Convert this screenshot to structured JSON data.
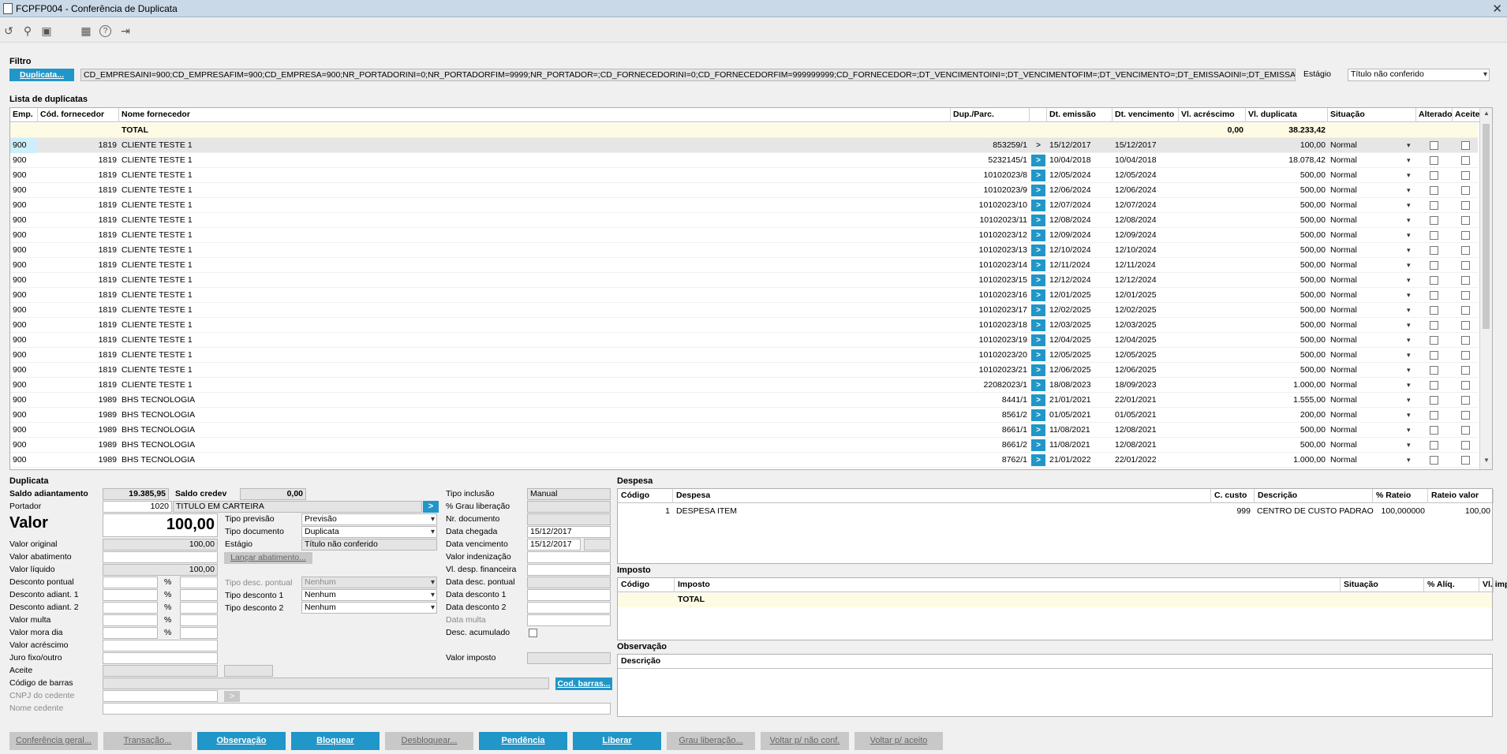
{
  "window": {
    "title": "FCPFP004 - Conferência de Duplicata",
    "close_glyph": "✕"
  },
  "toolbar": {
    "icons": [
      "undo-icon",
      "search-icon",
      "save-icon",
      "calendar-icon",
      "help-icon",
      "exit-icon"
    ],
    "glyphs": [
      "↺",
      "⚲",
      "▣",
      "▦",
      "?",
      "⇥"
    ]
  },
  "filtro": {
    "section": "Filtro",
    "duplicata_button": "Duplicata...",
    "filter_text": "CD_EMPRESAINI=900;CD_EMPRESAFIM=900;CD_EMPRESA=900;NR_PORTADORINI=0;NR_PORTADORFIM=9999;NR_PORTADOR=;CD_FORNECEDORINI=0;CD_FORNECEDORFIM=999999999;CD_FORNECEDOR=;DT_VENCIMENTOINI=;DT_VENCIMENTOFIM=;DT_VENCIMENTO=;DT_EMISSAOINI=;DT_EMISSAOFIM=",
    "estagio_label": "Estágio",
    "estagio_value": "Título não conferido"
  },
  "lista": {
    "section": "Lista de duplicatas",
    "columns": [
      "Emp.",
      "Cód. fornecedor",
      "Nome fornecedor",
      "Dup./Parc.",
      "",
      "Dt. emissão",
      "Dt. vencimento",
      "Vl. acréscimo",
      "Vl. duplicata",
      "Situação",
      "Alterado",
      "Aceite"
    ],
    "total": {
      "label": "TOTAL",
      "acrescimo": "0,00",
      "duplicata": "38.233,42"
    },
    "rows": [
      {
        "emp": "900",
        "cod": "1819",
        "nome": "CLIENTE TESTE 1",
        "dup": "853259/1",
        "emis": "15/12/2017",
        "venc": "15/12/2017",
        "valor": "100,00",
        "sit": "Normal"
      },
      {
        "emp": "900",
        "cod": "1819",
        "nome": "CLIENTE TESTE 1",
        "dup": "5232145/1",
        "emis": "10/04/2018",
        "venc": "10/04/2018",
        "valor": "18.078,42",
        "sit": "Normal"
      },
      {
        "emp": "900",
        "cod": "1819",
        "nome": "CLIENTE TESTE 1",
        "dup": "10102023/8",
        "emis": "12/05/2024",
        "venc": "12/05/2024",
        "valor": "500,00",
        "sit": "Normal"
      },
      {
        "emp": "900",
        "cod": "1819",
        "nome": "CLIENTE TESTE 1",
        "dup": "10102023/9",
        "emis": "12/06/2024",
        "venc": "12/06/2024",
        "valor": "500,00",
        "sit": "Normal"
      },
      {
        "emp": "900",
        "cod": "1819",
        "nome": "CLIENTE TESTE 1",
        "dup": "10102023/10",
        "emis": "12/07/2024",
        "venc": "12/07/2024",
        "valor": "500,00",
        "sit": "Normal"
      },
      {
        "emp": "900",
        "cod": "1819",
        "nome": "CLIENTE TESTE 1",
        "dup": "10102023/11",
        "emis": "12/08/2024",
        "venc": "12/08/2024",
        "valor": "500,00",
        "sit": "Normal"
      },
      {
        "emp": "900",
        "cod": "1819",
        "nome": "CLIENTE TESTE 1",
        "dup": "10102023/12",
        "emis": "12/09/2024",
        "venc": "12/09/2024",
        "valor": "500,00",
        "sit": "Normal"
      },
      {
        "emp": "900",
        "cod": "1819",
        "nome": "CLIENTE TESTE 1",
        "dup": "10102023/13",
        "emis": "12/10/2024",
        "venc": "12/10/2024",
        "valor": "500,00",
        "sit": "Normal"
      },
      {
        "emp": "900",
        "cod": "1819",
        "nome": "CLIENTE TESTE 1",
        "dup": "10102023/14",
        "emis": "12/11/2024",
        "venc": "12/11/2024",
        "valor": "500,00",
        "sit": "Normal"
      },
      {
        "emp": "900",
        "cod": "1819",
        "nome": "CLIENTE TESTE 1",
        "dup": "10102023/15",
        "emis": "12/12/2024",
        "venc": "12/12/2024",
        "valor": "500,00",
        "sit": "Normal"
      },
      {
        "emp": "900",
        "cod": "1819",
        "nome": "CLIENTE TESTE 1",
        "dup": "10102023/16",
        "emis": "12/01/2025",
        "venc": "12/01/2025",
        "valor": "500,00",
        "sit": "Normal"
      },
      {
        "emp": "900",
        "cod": "1819",
        "nome": "CLIENTE TESTE 1",
        "dup": "10102023/17",
        "emis": "12/02/2025",
        "venc": "12/02/2025",
        "valor": "500,00",
        "sit": "Normal"
      },
      {
        "emp": "900",
        "cod": "1819",
        "nome": "CLIENTE TESTE 1",
        "dup": "10102023/18",
        "emis": "12/03/2025",
        "venc": "12/03/2025",
        "valor": "500,00",
        "sit": "Normal"
      },
      {
        "emp": "900",
        "cod": "1819",
        "nome": "CLIENTE TESTE 1",
        "dup": "10102023/19",
        "emis": "12/04/2025",
        "venc": "12/04/2025",
        "valor": "500,00",
        "sit": "Normal"
      },
      {
        "emp": "900",
        "cod": "1819",
        "nome": "CLIENTE TESTE 1",
        "dup": "10102023/20",
        "emis": "12/05/2025",
        "venc": "12/05/2025",
        "valor": "500,00",
        "sit": "Normal"
      },
      {
        "emp": "900",
        "cod": "1819",
        "nome": "CLIENTE TESTE 1",
        "dup": "10102023/21",
        "emis": "12/06/2025",
        "venc": "12/06/2025",
        "valor": "500,00",
        "sit": "Normal"
      },
      {
        "emp": "900",
        "cod": "1819",
        "nome": "CLIENTE TESTE 1",
        "dup": "22082023/1",
        "emis": "18/08/2023",
        "venc": "18/09/2023",
        "valor": "1.000,00",
        "sit": "Normal"
      },
      {
        "emp": "900",
        "cod": "1989",
        "nome": "BHS TECNOLOGIA",
        "dup": "8441/1",
        "emis": "21/01/2021",
        "venc": "22/01/2021",
        "valor": "1.555,00",
        "sit": "Normal"
      },
      {
        "emp": "900",
        "cod": "1989",
        "nome": "BHS TECNOLOGIA",
        "dup": "8561/2",
        "emis": "01/05/2021",
        "venc": "01/05/2021",
        "valor": "200,00",
        "sit": "Normal"
      },
      {
        "emp": "900",
        "cod": "1989",
        "nome": "BHS TECNOLOGIA",
        "dup": "8661/1",
        "emis": "11/08/2021",
        "venc": "12/08/2021",
        "valor": "500,00",
        "sit": "Normal"
      },
      {
        "emp": "900",
        "cod": "1989",
        "nome": "BHS TECNOLOGIA",
        "dup": "8661/2",
        "emis": "11/08/2021",
        "venc": "12/08/2021",
        "valor": "500,00",
        "sit": "Normal"
      },
      {
        "emp": "900",
        "cod": "1989",
        "nome": "BHS TECNOLOGIA",
        "dup": "8762/1",
        "emis": "21/01/2022",
        "venc": "22/01/2022",
        "valor": "1.000,00",
        "sit": "Normal"
      }
    ],
    "arrow_glyph": ">"
  },
  "duplicata": {
    "section": "Duplicata",
    "saldo_adiantamento_label": "Saldo adiantamento",
    "saldo_adiantamento": "19.385,95",
    "saldo_credev_label": "Saldo credev",
    "saldo_credev": "0,00",
    "portador_label": "Portador",
    "portador_code": "1020",
    "portador_name": "TITULO EM CARTEIRA",
    "valor_label": "Valor",
    "valor": "100,00",
    "tipo_previsao_label": "Tipo previsão",
    "tipo_previsao": "Previsão",
    "tipo_documento_label": "Tipo documento",
    "tipo_documento": "Duplicata",
    "estagio_label": "Estágio",
    "estagio": "Título não conferido",
    "lancar_abatimento": "Lançar abatimento...",
    "valor_original_label": "Valor original",
    "valor_original": "100,00",
    "valor_abatimento_label": "Valor abatimento",
    "valor_liquido_label": "Valor líquido",
    "valor_liquido": "100,00",
    "desconto_pontual_label": "Desconto pontual",
    "desconto_adiant1_label": "Desconto adiant. 1",
    "desconto_adiant2_label": "Desconto adiant. 2",
    "valor_multa_label": "Valor multa",
    "valor_mora_dia_label": "Valor mora dia",
    "valor_acrescimo_label": "Valor acréscimo",
    "juro_label": "Juro fixo/outro",
    "aceite_label": "Aceite",
    "codigo_barras_label": "Código de barras",
    "cod_barras_button": "Cod. barras...",
    "cnpj_label": "CNPJ do cedente",
    "nome_cedente_label": "Nome cedente",
    "percent": "%",
    "tipo_desc_pontual_label": "Tipo desc. pontual",
    "tipo_desc_pontual": "Nenhum",
    "tipo_desconto1_label": "Tipo desconto 1",
    "tipo_desconto1": "Nenhum",
    "tipo_desconto2_label": "Tipo desconto 2",
    "tipo_desconto2": "Nenhum",
    "tipo_inclusao_label": "Tipo inclusão",
    "tipo_inclusao": "Manual",
    "grau_liberacao_label": "% Grau liberação",
    "nr_documento_label": "Nr. documento",
    "data_chegada_label": "Data chegada",
    "data_chegada": "15/12/2017",
    "data_vencimento_label": "Data vencimento",
    "data_vencimento": "15/12/2017",
    "valor_indenizacao_label": "Valor indenização",
    "vl_desp_financeira_label": "Vl. desp. financeira",
    "data_desc_pontual_label": "Data desc. pontual",
    "data_desconto1_label": "Data desconto 1",
    "data_desconto2_label": "Data desconto 2",
    "data_multa_label": "Data multa",
    "desc_acumulado_label": "Desc. acumulado",
    "valor_imposto_label": "Valor imposto"
  },
  "despesa": {
    "section": "Despesa",
    "columns": [
      "Código",
      "Despesa",
      "C. custo",
      "Descrição",
      "% Rateio",
      "Rateio valor"
    ],
    "rows": [
      {
        "codigo": "1",
        "despesa": "DESPESA ITEM",
        "ccusto": "999",
        "descricao": "CENTRO DE CUSTO PADRAO",
        "rateio": "100,000000",
        "valor": "100,00"
      }
    ]
  },
  "imposto": {
    "section": "Imposto",
    "columns": [
      "Código",
      "Imposto",
      "Situação",
      "% Alíq.",
      "Vl. imposto"
    ],
    "total": "TOTAL"
  },
  "observacao": {
    "section": "Observação",
    "column": "Descrição"
  },
  "footer": {
    "buttons": [
      {
        "label": "Conferência geral...",
        "style": "gray"
      },
      {
        "label": "Transação...",
        "style": "gray"
      },
      {
        "label": "Observação",
        "style": "blue"
      },
      {
        "label": "Bloquear",
        "style": "blue"
      },
      {
        "label": "Desbloquear...",
        "style": "gray"
      },
      {
        "label": "Pendência",
        "style": "blue"
      },
      {
        "label": "Liberar",
        "style": "blue"
      },
      {
        "label": "Grau liberação...",
        "style": "gray"
      },
      {
        "label": "Voltar p/ não conf.",
        "style": "gray"
      },
      {
        "label": "Voltar p/ aceito",
        "style": "gray"
      }
    ]
  },
  "colors": {
    "accent": "#2196c8",
    "total_row": "#fdfbe3",
    "titlebar": "#c9d9e8"
  }
}
